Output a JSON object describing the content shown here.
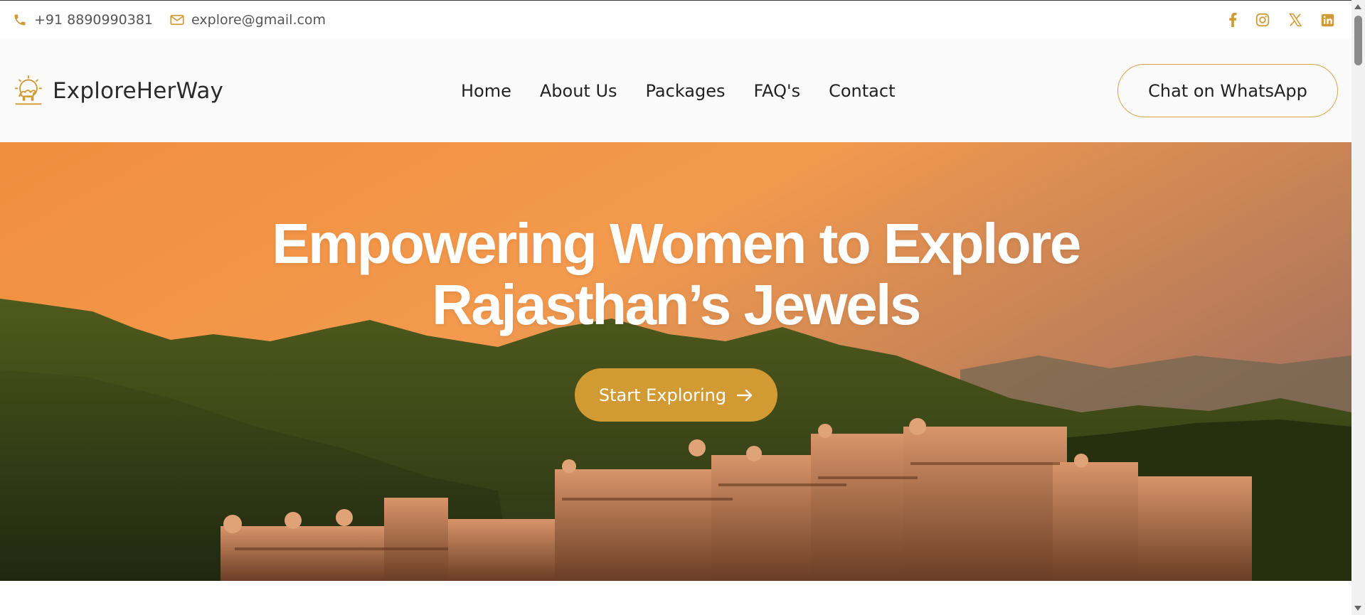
{
  "topbar": {
    "phone": "+91 8890990381",
    "email": "explore@gmail.com",
    "socials": [
      "facebook-icon",
      "instagram-icon",
      "x-icon",
      "linkedin-icon"
    ]
  },
  "header": {
    "brand": "ExploreHerWay",
    "nav": [
      "Home",
      "About Us",
      "Packages",
      "FAQ's",
      "Contact"
    ],
    "cta_label": "Chat on WhatsApp"
  },
  "hero": {
    "title_line1": "Empowering Women to Explore",
    "title_line2": "Rajasthan’s Jewels",
    "button_label": "Start Exploring"
  },
  "colors": {
    "accent": "#d29a32",
    "accent_light": "#d8a54d",
    "text_dark": "#222222",
    "text_muted": "#555555"
  }
}
